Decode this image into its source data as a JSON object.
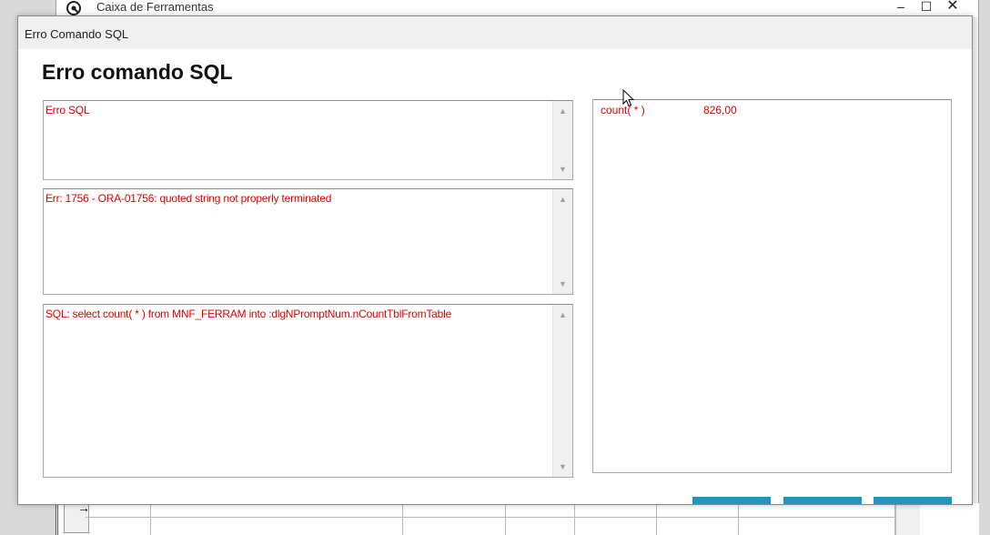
{
  "background_window": {
    "title": "Caixa de Ferramentas",
    "icon": "toolbox-app-icon",
    "controls": {
      "minimize": "–",
      "maximize": "☐",
      "close": "✕"
    }
  },
  "dialog": {
    "window_title": "Erro Comando SQL",
    "heading": "Erro comando SQL",
    "messages": [
      {
        "text": "Erro SQL"
      },
      {
        "text": "Err: 1756 - ORA-01756: quoted string not properly terminated"
      },
      {
        "text": "SQL: select count( * ) from MNF_FERRAM into :dlgNPromptNum.nCountTblFromTable"
      }
    ],
    "scroll": {
      "up": "▲",
      "down": "▼"
    },
    "result": {
      "label": "count( * )",
      "value": "826,00"
    }
  },
  "colors": {
    "error_text": "#e00000",
    "button_accent": "#1a9bbd"
  },
  "grid": {
    "row_indicator": "→",
    "dropdown_arrow": "⌄"
  }
}
